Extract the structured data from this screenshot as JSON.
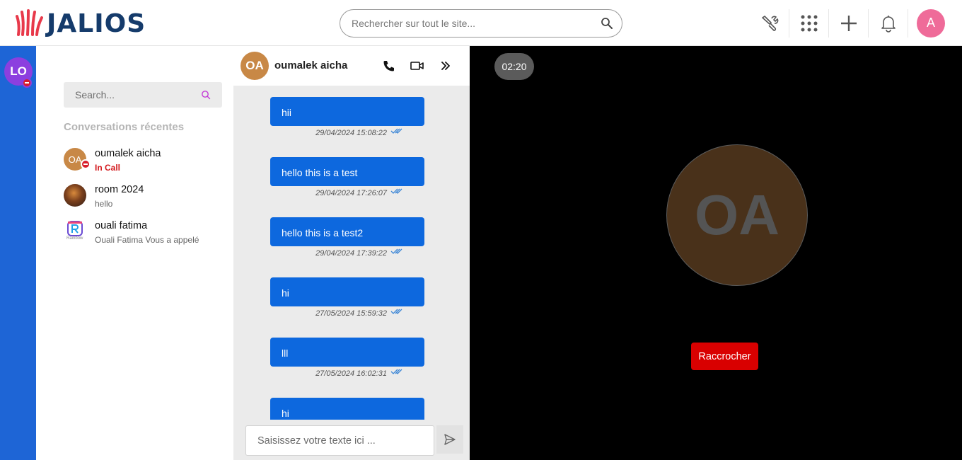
{
  "header": {
    "logo_text": "JALIOS",
    "search_placeholder": "Rechercher sur tout le site...",
    "icons": [
      "wrench-icon",
      "apps-grid-icon",
      "plus-icon",
      "bell-icon"
    ],
    "user_initial": "A"
  },
  "sidebar": {
    "user_initials": "LO"
  },
  "conversations": {
    "search_placeholder": "Search...",
    "section_title": "Conversations récentes",
    "items": [
      {
        "initials": "OA",
        "name": "oumalek aicha",
        "status": "In Call"
      },
      {
        "name": "room 2024",
        "last_message": "hello"
      },
      {
        "name": "ouali fatima",
        "last_message": "Ouali Fatima Vous a appelé",
        "logo_text": "Rainbow"
      }
    ]
  },
  "chat": {
    "contact_initials": "OA",
    "contact_name": "oumalek aicha",
    "messages": [
      {
        "text": "hii",
        "timestamp": "29/04/2024 15:08:22"
      },
      {
        "text": "hello this is a test",
        "timestamp": "29/04/2024 17:26:07"
      },
      {
        "text": "hello this is a test2",
        "timestamp": "29/04/2024 17:39:22"
      },
      {
        "text": "hi",
        "timestamp": "27/05/2024 15:59:32"
      },
      {
        "text": "lll",
        "timestamp": "27/05/2024 16:02:31"
      },
      {
        "text": "hi",
        "timestamp": ""
      }
    ],
    "input_placeholder": "Saisissez votre texte ici ..."
  },
  "call": {
    "timer": "02:20",
    "remote_initials": "OA",
    "hangup_label": "Raccrocher"
  },
  "colors": {
    "brand_red": "#e8394a",
    "brand_navy": "#153b6b",
    "bubble_blue": "#0d68de",
    "strip_blue": "#1e65d6",
    "hangup_red": "#d90000",
    "status_red": "#d3191d"
  }
}
